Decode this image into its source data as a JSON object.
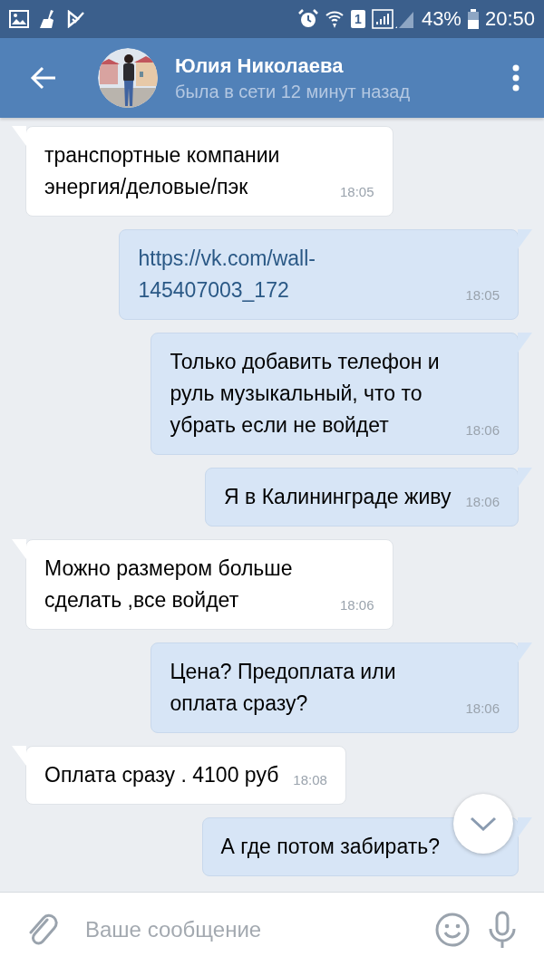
{
  "status_bar": {
    "sim_slot": "1",
    "battery": "43%",
    "time": "20:50"
  },
  "header": {
    "name": "Юлия Николаева",
    "status": "была в сети 12 минут назад"
  },
  "messages": [
    {
      "outgoing": false,
      "kind": "text",
      "text": "транспортные компании энергия/деловые/пэк",
      "time": "18:05"
    },
    {
      "outgoing": true,
      "kind": "link",
      "text": "https://vk.com/wall-145407003_172",
      "time": "18:05"
    },
    {
      "outgoing": true,
      "kind": "text",
      "text": "Только добавить телефон и руль музыкальный, что то убрать если не войдет",
      "time": "18:06"
    },
    {
      "outgoing": true,
      "kind": "text",
      "text": "Я в Калининграде живу",
      "time": "18:06"
    },
    {
      "outgoing": false,
      "kind": "text",
      "text": "Можно размером больше сделать ,все войдет",
      "time": "18:06"
    },
    {
      "outgoing": true,
      "kind": "text",
      "text": "Цена? Предоплата или оплата сразу?",
      "time": "18:06"
    },
    {
      "outgoing": false,
      "kind": "text",
      "text": "Оплата сразу . 4100 руб",
      "time": "18:08"
    },
    {
      "outgoing": true,
      "kind": "text",
      "text": "А где потом забирать?"
    }
  ],
  "composer": {
    "placeholder": "Ваше сообщение"
  }
}
